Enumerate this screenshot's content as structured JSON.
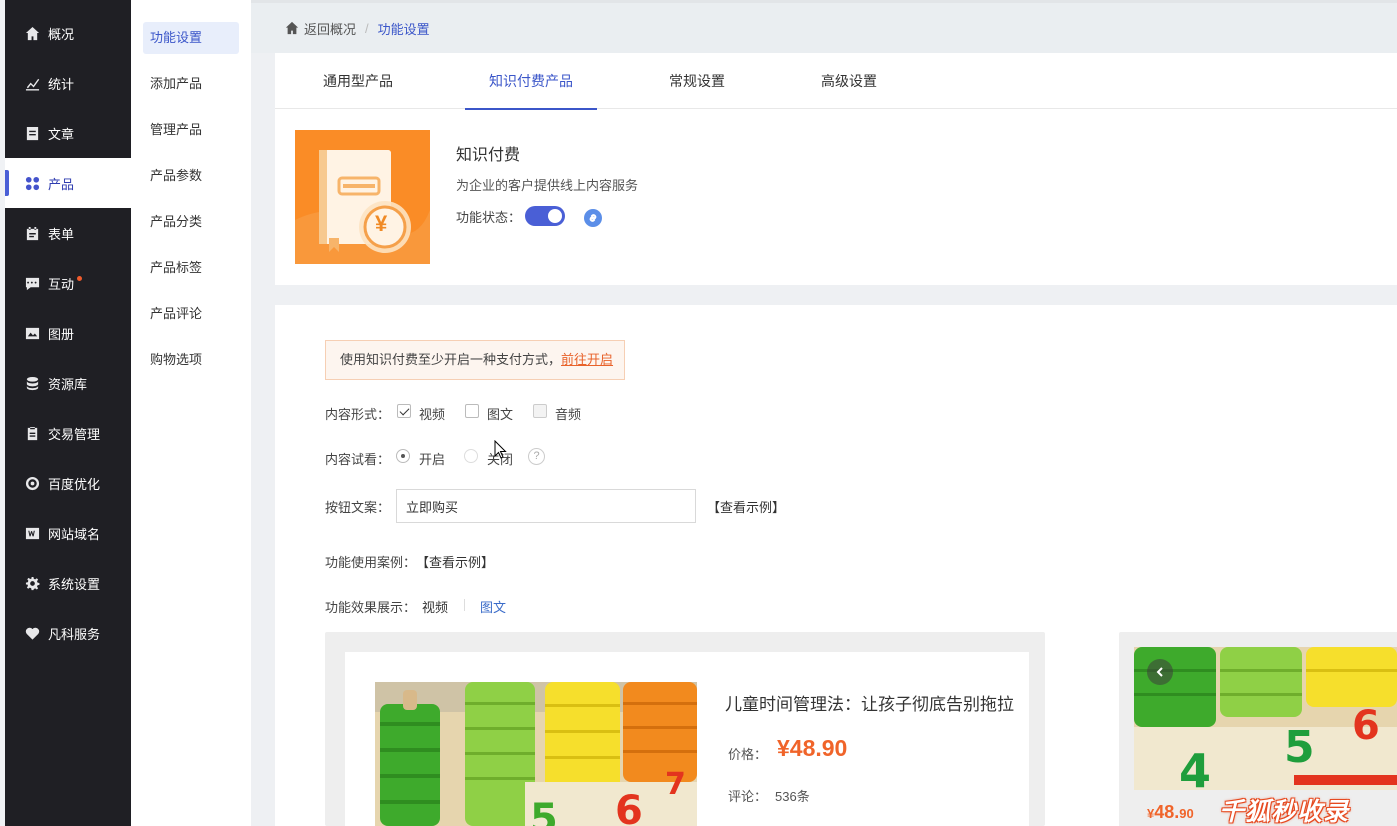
{
  "nav": {
    "items": [
      {
        "label": "概况",
        "icon": "home-icon"
      },
      {
        "label": "统计",
        "icon": "stats-icon"
      },
      {
        "label": "文章",
        "icon": "article-icon"
      },
      {
        "label": "产品",
        "icon": "product-icon"
      },
      {
        "label": "表单",
        "icon": "form-icon"
      },
      {
        "label": "互动",
        "icon": "chat-icon"
      },
      {
        "label": "图册",
        "icon": "gallery-icon"
      },
      {
        "label": "资源库",
        "icon": "database-icon"
      },
      {
        "label": "交易管理",
        "icon": "trade-icon"
      },
      {
        "label": "百度优化",
        "icon": "seo-icon"
      },
      {
        "label": "网站域名",
        "icon": "domain-icon"
      },
      {
        "label": "系统设置",
        "icon": "gear-icon"
      },
      {
        "label": "凡科服务",
        "icon": "heart-icon"
      }
    ],
    "active_index": 3
  },
  "subnav": {
    "items": [
      "功能设置",
      "添加产品",
      "管理产品",
      "产品参数",
      "产品分类",
      "产品标签",
      "产品评论",
      "购物选项"
    ]
  },
  "breadcrumb": {
    "back_label": "返回概况",
    "separator": "/",
    "current": "功能设置"
  },
  "tabs": [
    "通用型产品",
    "知识付费产品",
    "常规设置",
    "高级设置"
  ],
  "feature": {
    "title": "知识付费",
    "description": "为企业的客户提供线上内容服务",
    "status_label": "功能状态：",
    "status_on": true,
    "thumb_symbol": "¥"
  },
  "form": {
    "notice_text": "使用知识付费至少开启一种支付方式，",
    "notice_link": "前往开启",
    "content_type_label": "内容形式：",
    "content_types": [
      {
        "label": "视频",
        "checked": true
      },
      {
        "label": "图文",
        "checked": false
      },
      {
        "label": "音频",
        "checked": false
      }
    ],
    "preview_label": "内容试看：",
    "preview_options": [
      {
        "label": "开启",
        "selected": true
      },
      {
        "label": "关闭",
        "selected": false
      }
    ],
    "help_symbol": "?",
    "button_text_label": "按钮文案：",
    "button_text_value": "立即购买",
    "view_example": "【查看示例】",
    "case_label": "功能使用案例：",
    "case_link": "【查看示例】",
    "effect_label": "功能效果展示：",
    "effect_tabs": [
      "视频",
      "图文"
    ]
  },
  "preview": {
    "title": "儿童时间管理法：让孩子彻底告别拖拉",
    "price_label": "价格：",
    "price_value": "¥48.90",
    "reviews_label": "评论：",
    "reviews_value": "536条",
    "right_price_symbol": "¥",
    "right_price_main": "48.",
    "right_price_small": "90",
    "watermark": "千狐秒收录"
  },
  "colors": {
    "accent": "#3b56c9",
    "price": "#f0642a",
    "nav_bg": "#1f1f24"
  }
}
